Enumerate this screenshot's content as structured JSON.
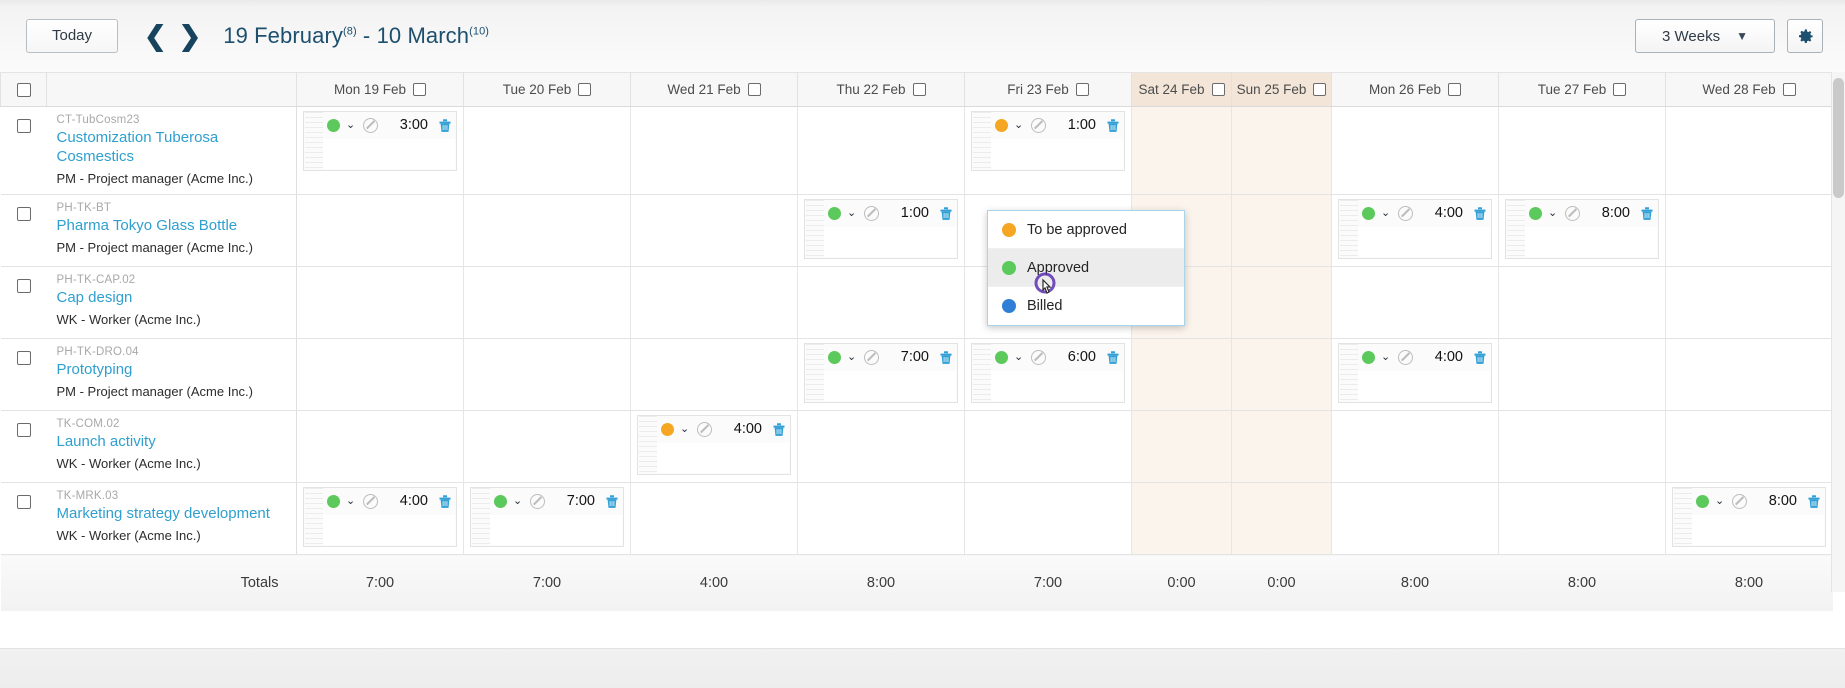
{
  "toolbar": {
    "today_label": "Today",
    "prev_icon": "chevron-left-icon",
    "next_icon": "chevron-right-icon",
    "date_range_start": "19 February",
    "date_range_start_sup": "(8)",
    "date_range_sep": " - ",
    "date_range_end": "10 March",
    "date_range_end_sup": "(10)",
    "weeks_label": "3 Weeks",
    "settings_icon": "gear-icon"
  },
  "columns": [
    {
      "label": "Mon 19 Feb",
      "weekend": false
    },
    {
      "label": "Tue 20 Feb",
      "weekend": false
    },
    {
      "label": "Wed 21 Feb",
      "weekend": false
    },
    {
      "label": "Thu 22 Feb",
      "weekend": false
    },
    {
      "label": "Fri 23 Feb",
      "weekend": false
    },
    {
      "label": "Sat 24 Feb",
      "weekend": true
    },
    {
      "label": "Sun 25 Feb",
      "weekend": true
    },
    {
      "label": "Mon 26 Feb",
      "weekend": false
    },
    {
      "label": "Tue 27 Feb",
      "weekend": false
    },
    {
      "label": "Wed 28 Feb",
      "weekend": false
    }
  ],
  "rows": [
    {
      "code": "CT-TubCosm23",
      "name": "Customization Tuberosa Cosmestics",
      "role": "PM - Project manager (Acme Inc.)",
      "entries": {
        "0": {
          "hours": "3:00",
          "status": "approved"
        },
        "4": {
          "hours": "1:00",
          "status": "toapprove"
        }
      }
    },
    {
      "code": "PH-TK-BT",
      "name": "Pharma Tokyo Glass Bottle",
      "role": "PM - Project manager (Acme Inc.)",
      "entries": {
        "3": {
          "hours": "1:00",
          "status": "approved"
        },
        "7": {
          "hours": "4:00",
          "status": "approved"
        },
        "8": {
          "hours": "8:00",
          "status": "approved"
        }
      }
    },
    {
      "code": "PH-TK-CAP.02",
      "name": "Cap design",
      "role": "WK - Worker (Acme Inc.)",
      "entries": {}
    },
    {
      "code": "PH-TK-DRO.04",
      "name": "Prototyping",
      "role": "PM - Project manager (Acme Inc.)",
      "entries": {
        "3": {
          "hours": "7:00",
          "status": "approved"
        },
        "4": {
          "hours": "6:00",
          "status": "approved"
        },
        "7": {
          "hours": "4:00",
          "status": "approved"
        }
      }
    },
    {
      "code": "TK-COM.02",
      "name": "Launch activity",
      "role": "WK - Worker (Acme Inc.)",
      "entries": {
        "2": {
          "hours": "4:00",
          "status": "toapprove"
        }
      }
    },
    {
      "code": "TK-MRK.03",
      "name": "Marketing strategy development",
      "role": "WK - Worker (Acme Inc.)",
      "entries": {
        "0": {
          "hours": "4:00",
          "status": "approved"
        },
        "1": {
          "hours": "7:00",
          "status": "approved"
        },
        "9": {
          "hours": "8:00",
          "status": "approved"
        }
      }
    }
  ],
  "totals": {
    "label": "Totals",
    "values": [
      "7:00",
      "7:00",
      "4:00",
      "8:00",
      "7:00",
      "0:00",
      "0:00",
      "8:00",
      "8:00",
      "8:00"
    ]
  },
  "status_dropdown": {
    "open": true,
    "items": [
      {
        "label": "To be approved",
        "color_key": "toapprove",
        "hovered": false
      },
      {
        "label": "Approved",
        "color_key": "approved",
        "hovered": true
      },
      {
        "label": "Billed",
        "color_key": "billed",
        "hovered": false
      }
    ]
  },
  "colors": {
    "toapprove": "#f5a623",
    "approved": "#5cc95c",
    "billed": "#2f7fd6",
    "link": "#2f9fd0",
    "heading": "#1d4f6e",
    "weekend_header": "#f3e6d8",
    "weekend_cell": "#fbf4ec",
    "trash": "#2f9fd6"
  },
  "icons": {
    "no_clock": "no-timer-icon",
    "delete": "trash-icon",
    "status_caret": "chevron-down-icon",
    "cursor": "pointer-hand-cursor"
  }
}
